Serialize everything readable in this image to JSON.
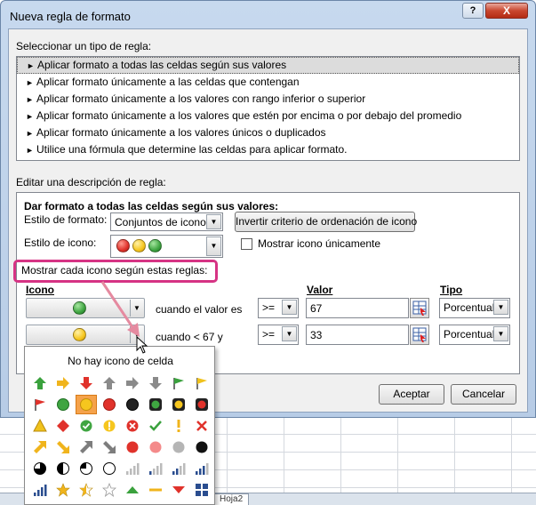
{
  "window": {
    "title": "Nueva regla de formato",
    "help": "?",
    "close": "X"
  },
  "select_rule": {
    "label": "Seleccionar un tipo de regla:",
    "items": [
      "Aplicar formato a todas las celdas según sus valores",
      "Aplicar formato únicamente a las celdas que contengan",
      "Aplicar formato únicamente a los valores con rango inferior o superior",
      "Aplicar formato únicamente a los valores que estén por encima o por debajo del promedio",
      "Aplicar formato únicamente a los valores únicos o duplicados",
      "Utilice una fórmula que determine las celdas para aplicar formato."
    ]
  },
  "edit_rule": {
    "label": "Editar una descripción de regla:",
    "heading": "Dar formato a todas las celdas según sus valores:",
    "format_style_label": "Estilo de formato:",
    "format_style_value": "Conjuntos de iconos",
    "reverse_button": "Invertir criterio de ordenación de icono",
    "icon_style_label": "Estilo de icono:",
    "show_icon_only": "Mostrar icono únicamente",
    "rules_label": "Mostrar cada icono según estas reglas:",
    "col_icon": "Icono",
    "col_value": "Valor",
    "col_type": "Tipo",
    "rows": [
      {
        "condition": "cuando el valor es",
        "operator": ">=",
        "value": "67",
        "type": "Porcentual"
      },
      {
        "condition": "cuando < 67 y",
        "operator": ">=",
        "value": "33",
        "type": "Porcentual"
      }
    ]
  },
  "buttons": {
    "ok": "Aceptar",
    "cancel": "Cancelar"
  },
  "popup": {
    "title": "No hay icono de celda"
  },
  "sheet": {
    "tab": "Hoja2"
  },
  "colors": {
    "red": "#e0322b",
    "yellow": "#f6c61e",
    "green": "#3fa541",
    "highlight": "#d63384",
    "selected_cell": "#f5a24b"
  }
}
